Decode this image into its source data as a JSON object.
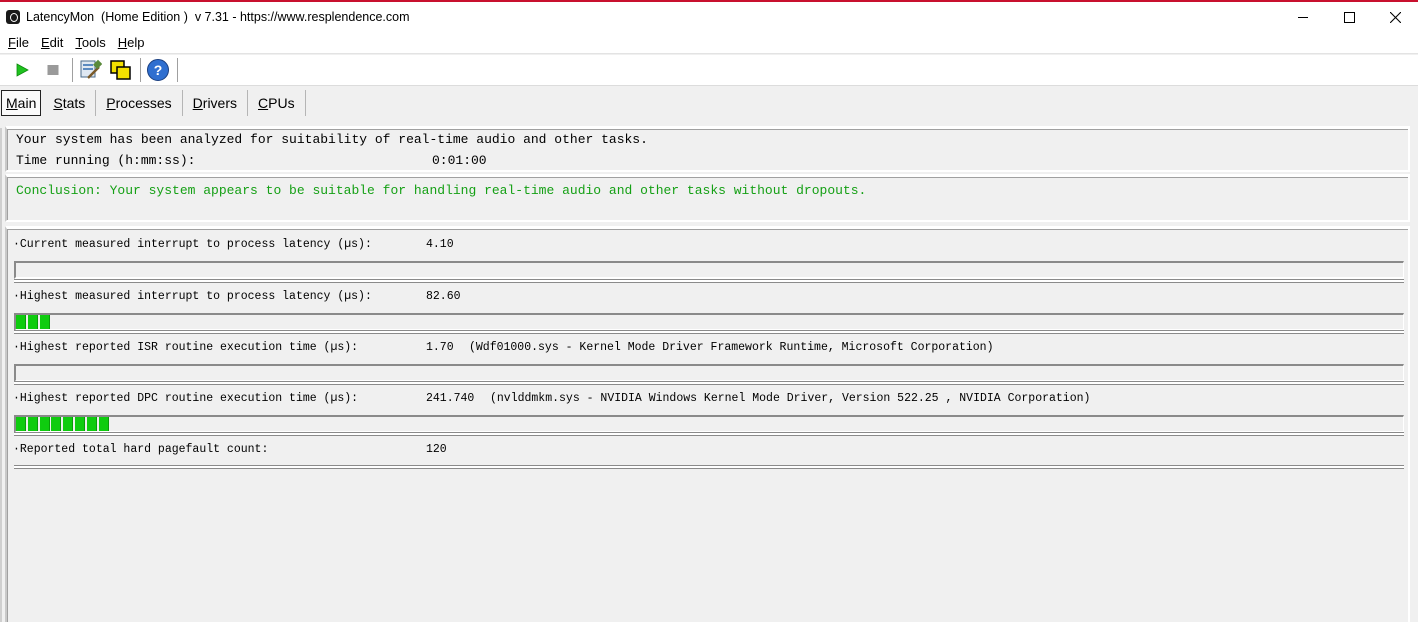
{
  "window": {
    "title": "LatencyMon  (Home Edition )  v 7.31 - https://www.resplendence.com"
  },
  "menu": [
    {
      "underline": "F",
      "rest": "ile"
    },
    {
      "underline": "E",
      "rest": "dit"
    },
    {
      "underline": "T",
      "rest": "ools"
    },
    {
      "underline": "H",
      "rest": "elp"
    }
  ],
  "toolbar": {
    "icons": [
      "play-icon",
      "stop-icon",
      "process-tools-icon",
      "copy-windows-icon",
      "help-icon"
    ]
  },
  "tabs": [
    {
      "underline": "M",
      "rest": "ain",
      "active": true
    },
    {
      "underline": "S",
      "rest": "tats",
      "active": false
    },
    {
      "underline": "P",
      "rest": "rocesses",
      "active": false
    },
    {
      "underline": "D",
      "rest": "rivers",
      "active": false
    },
    {
      "underline": "C",
      "rest": "PUs",
      "active": false
    }
  ],
  "summary": {
    "line1": "Your system has been analyzed for suitability of real-time audio and other tasks.",
    "time_label": "Time running (h:mm:ss):",
    "time_value": "0:01:00"
  },
  "conclusion": "Conclusion: Your system appears to be suitable for handling real-time audio and other tasks without dropouts.",
  "metrics": [
    {
      "label": "·Current measured interrupt to process latency (µs):",
      "value": "4.10",
      "detail": "",
      "segments": 0
    },
    {
      "label": "·Highest measured interrupt to process latency (µs):",
      "value": "82.60",
      "detail": "",
      "segments": 3
    },
    {
      "label": "·Highest reported ISR routine execution time (µs):",
      "value": "1.70",
      "detail": "(Wdf01000.sys - Kernel Mode Driver Framework Runtime, Microsoft Corporation)",
      "segments": 0
    },
    {
      "label": "·Highest reported DPC routine execution time (µs):",
      "value": "241.740",
      "detail": "(nvlddmkm.sys - NVIDIA Windows Kernel Mode Driver, Version 522.25 , NVIDIA Corporation)",
      "segments": 8
    },
    {
      "label": "·Reported total hard pagefault count:",
      "value": "120",
      "detail": "",
      "segments": null
    }
  ],
  "colors": {
    "conclusion": "#15a015",
    "bar_fill": "#0fcc0f"
  }
}
